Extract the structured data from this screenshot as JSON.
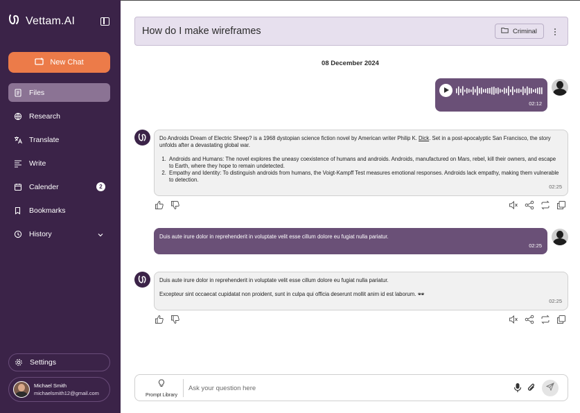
{
  "sidebar": {
    "brand": "Vettam.AI",
    "new_chat_label": "New Chat",
    "items": [
      {
        "label": "Files",
        "icon": "files-icon",
        "active": true
      },
      {
        "label": "Research",
        "icon": "globe-icon"
      },
      {
        "label": "Translate",
        "icon": "translate-icon"
      },
      {
        "label": "Write",
        "icon": "write-icon"
      },
      {
        "label": "Calender",
        "icon": "calendar-icon",
        "badge": "2"
      },
      {
        "label": "Bookmarks",
        "icon": "bookmark-icon"
      },
      {
        "label": "History",
        "icon": "history-icon"
      }
    ],
    "settings_label": "Settings",
    "profile": {
      "name": "Michael Smith",
      "email": "michaelsmith12@gmail.com"
    }
  },
  "chat": {
    "title": "How do I make wireframes",
    "tag": "Criminal",
    "date": "08 December 2024",
    "voice_message": {
      "duration": "02:12"
    },
    "bot_message_1": {
      "intro_pre": "Do Androids Dream of Electric Sheep? is a 1968 dystopian science fiction novel by American writer Philip K. ",
      "intro_link": "Dick",
      "intro_post": ". Set in a post-apocalyptic San Francisco, the story unfolds after a devastating global war.",
      "points": [
        "Androids and Humans: The novel explores the uneasy coexistence of humans and androids. Androids, manufactured on Mars, rebel, kill their owners, and escape to Earth, where they hope to remain undetected.",
        "Empathy and Identity: To distinguish androids from humans, the Voigt-Kampff Test measures emotional responses. Androids lack empathy, making them vulnerable to detection."
      ],
      "time": "02:25"
    },
    "user_message": {
      "text": "Duis aute irure dolor in reprehenderit in voluptate velit esse cillum dolore eu fugiat nulla pariatur.",
      "time": "02:25"
    },
    "bot_message_2": {
      "line1": "Duis aute irure dolor in reprehenderit in voluptate velit esse cillum dolore eu fugiat nulla pariatur.",
      "line2": "Excepteur sint occaecat cupidatat non proident, sunt in culpa qui officia deserunt mollit anim id est laborum. 🕶",
      "time": "02:25"
    }
  },
  "composer": {
    "prompt_library_label": "Prompt Library",
    "placeholder": "Ask your question here"
  },
  "colors": {
    "sidebar_bg": "#3b2348",
    "accent": "#ec7b49",
    "user_bubble": "#6a5077",
    "header_bg": "#e7e0ee"
  }
}
